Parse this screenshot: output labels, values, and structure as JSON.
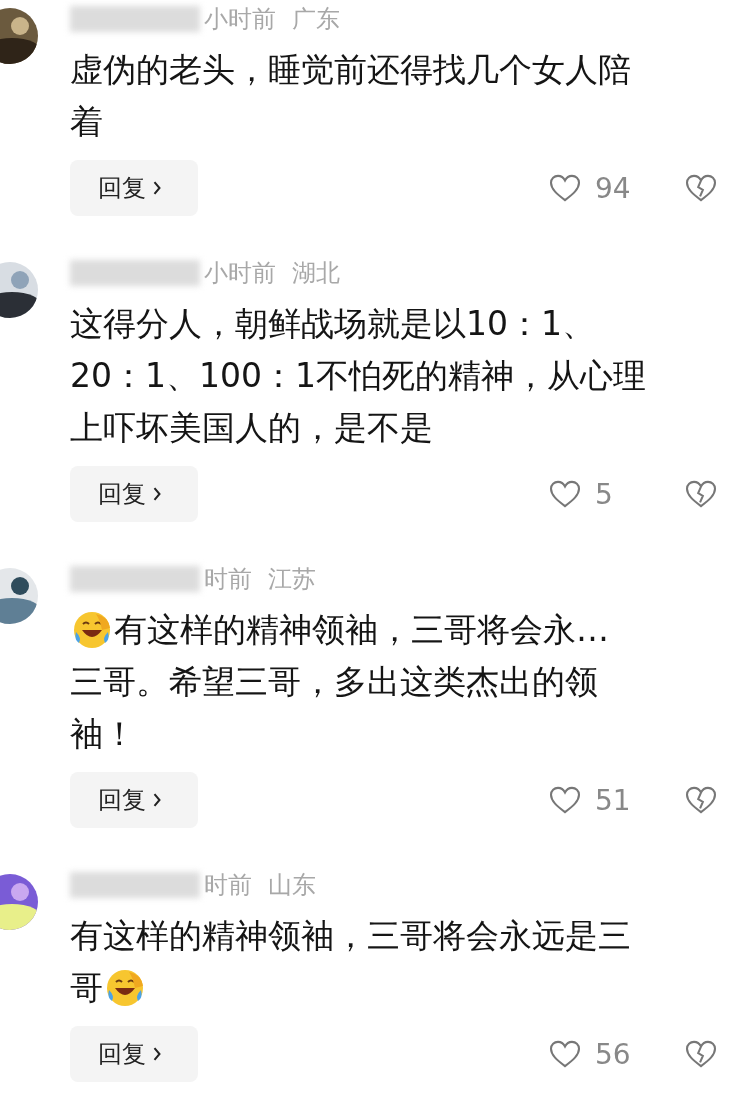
{
  "comments": [
    {
      "time": "小时前",
      "location": "广东",
      "body": [
        [
          {
            "kind": "text",
            "text": "虚伪的老头，睡觉前还得找几个女人陪"
          }
        ],
        [
          {
            "kind": "text",
            "text": "着"
          }
        ]
      ],
      "reply": "回复",
      "likes": "94"
    },
    {
      "time": "小时前",
      "location": "湖北",
      "body": [
        [
          {
            "kind": "text",
            "text": "这得分人，朝鲜战场就是以10：1、"
          }
        ],
        [
          {
            "kind": "text",
            "text": "20：1、100：1不怕死的精神，从心理"
          }
        ],
        [
          {
            "kind": "text",
            "text": "上吓坏美国人的，是不是"
          }
        ]
      ],
      "reply": "回复",
      "likes": "5"
    },
    {
      "time": "时前",
      "location": "江苏",
      "body": [
        [
          {
            "kind": "emoji"
          },
          {
            "kind": "text",
            "text": "有这样的精神领袖，三哥将会永…"
          }
        ],
        [
          {
            "kind": "text",
            "text": "三哥。希望三哥，多出这类杰出的领"
          }
        ],
        [
          {
            "kind": "text",
            "text": "袖！"
          }
        ]
      ],
      "reply": "回复",
      "likes": "51"
    },
    {
      "time": "时前",
      "location": "山东",
      "body": [
        [
          {
            "kind": "text",
            "text": "有这样的精神领袖，三哥将会永远是三"
          }
        ],
        [
          {
            "kind": "text",
            "text": "哥"
          },
          {
            "kind": "emoji"
          }
        ]
      ],
      "reply": "回复",
      "likes": "56"
    }
  ]
}
